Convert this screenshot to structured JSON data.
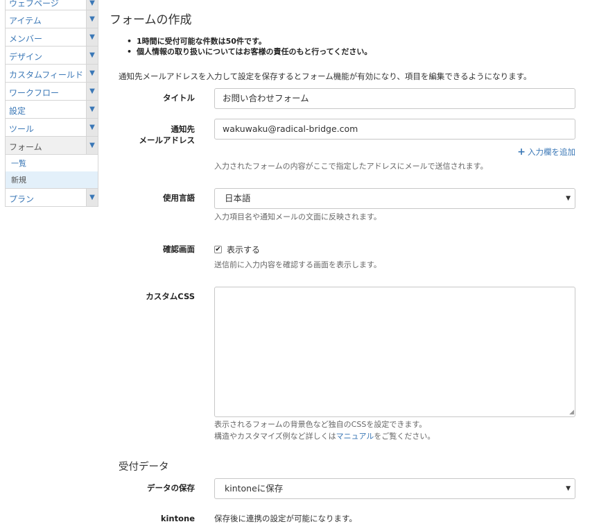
{
  "sidebar": {
    "items": [
      {
        "label": "ウェブページ"
      },
      {
        "label": "アイテム"
      },
      {
        "label": "メンバー"
      },
      {
        "label": "デザイン"
      },
      {
        "label": "カスタムフィールド"
      },
      {
        "label": "ワークフロー"
      },
      {
        "label": "設定"
      },
      {
        "label": "ツール"
      },
      {
        "label": "フォーム"
      },
      {
        "label": "プラン"
      }
    ],
    "submenu": [
      {
        "label": "一覧"
      },
      {
        "label": "新規"
      }
    ],
    "arrow_glyph": "▼"
  },
  "page": {
    "title": "フォームの作成",
    "notices": [
      "1時間に受付可能な件数は50件です。",
      "個人情報の取り扱いについてはお客様の責任のもと行ってください。"
    ],
    "intro": "通知先メールアドレスを入力して設定を保存するとフォーム機能が有効になり、項目を編集できるようになります。"
  },
  "form": {
    "title": {
      "label": "タイトル",
      "value": "お問い合わせフォーム"
    },
    "email": {
      "label_line1": "通知先",
      "label_line2": "メールアドレス",
      "value": "wakuwaku@radical-bridge.com",
      "add_field": "入力欄を追加",
      "help": "入力されたフォームの内容がここで指定したアドレスにメールで送信されます。"
    },
    "language": {
      "label": "使用言語",
      "value": "日本語",
      "help": "入力項目名や通知メールの文面に反映されます。"
    },
    "confirm": {
      "label": "確認画面",
      "checked": true,
      "check_label": "表示する",
      "help": "送信前に入力内容を確認する画面を表示します。"
    },
    "custom_css": {
      "label": "カスタムCSS",
      "value": "",
      "help_line1": "表示されるフォームの背景色など独自のCSSを設定できます。",
      "help_line2_before": "構造やカスタマイズ例など詳しくは",
      "help_link": "マニュアル",
      "help_line2_after": "をご覧ください。"
    }
  },
  "reception": {
    "section_title": "受付データ",
    "save": {
      "label": "データの保存",
      "value": "kintoneに保存"
    },
    "kintone": {
      "label": "kintone",
      "text": "保存後に連携の設定が可能になります。"
    }
  }
}
